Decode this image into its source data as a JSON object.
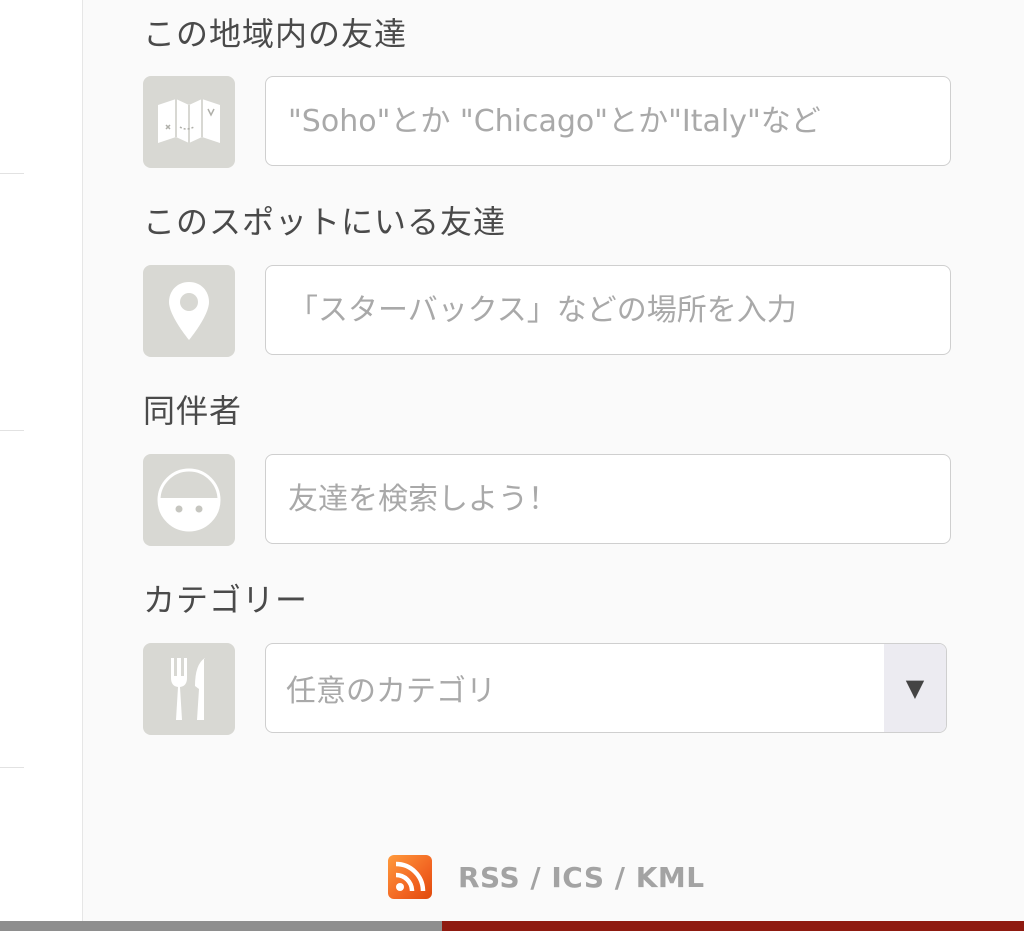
{
  "fields": {
    "area": {
      "label": "この地域内の友達",
      "placeholder": "\"Soho\"とか \"Chicago\"とか\"Italy\"など",
      "icon": "map-icon"
    },
    "spot": {
      "label": "このスポットにいる友達",
      "placeholder": "「スターバックス」などの場所を入力",
      "icon": "location-pin-icon"
    },
    "companion": {
      "label": "同伴者",
      "placeholder": "友達を検索しよう！",
      "icon": "friend-face-icon"
    },
    "category": {
      "label": "カテゴリー",
      "selected": "任意のカテゴリ",
      "arrow": "▼",
      "icon": "fork-knife-icon"
    }
  },
  "footer": {
    "feed_links": "RSS / ICS / KML",
    "icon": "rss-icon"
  },
  "colors": {
    "panel_bg": "#fafafa",
    "icon_tile_bg": "#d8d8d3",
    "label_text": "#4a4a4a",
    "placeholder_text": "#a9a9a9",
    "rss_orange": "#f26522",
    "bottom_bar_gray": "#8e8e8e",
    "bottom_bar_red": "#8f1a10"
  }
}
